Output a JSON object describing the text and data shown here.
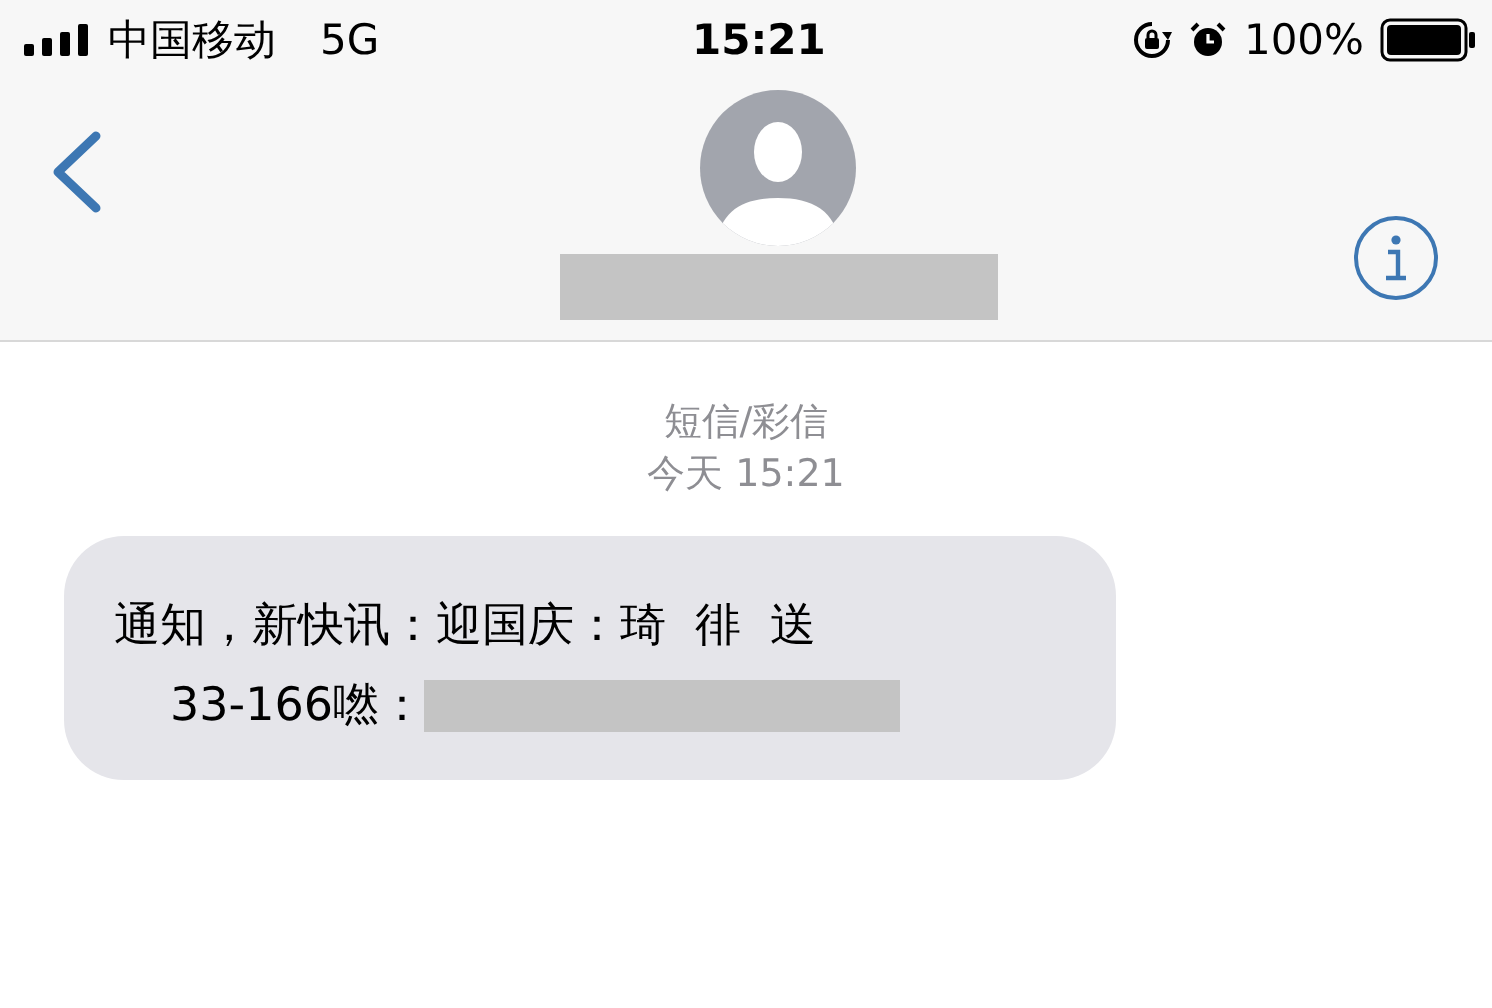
{
  "status_bar": {
    "carrier": "中国移动",
    "network": "5G",
    "time": "15:21",
    "battery": "100%"
  },
  "message_meta": {
    "type": "短信/彩信",
    "timestamp": "今天 15:21"
  },
  "message": {
    "lines": [
      "通知，新快讯：迎国庆：琦  徘  送",
      "33-166嘫："
    ]
  }
}
